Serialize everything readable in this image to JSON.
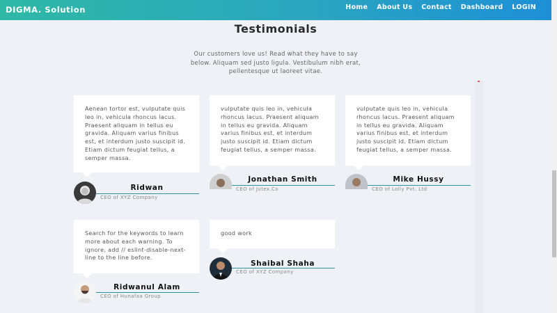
{
  "nav": {
    "brand": "DIGMA. Solution",
    "links": [
      "Home",
      "About Us",
      "Contact",
      "Dashboard",
      "LOGIN"
    ]
  },
  "section": {
    "title": "Testimonials",
    "subtitle": "Our customers love us! Read what they have to say below. Aliquam sed justo ligula. Vestibulum nibh erat, pellentesque ut laoreet vitae."
  },
  "testimonials": [
    {
      "text": "Aenean tortor est, vulputate quis leo in, vehicula rhoncus lacus. Praesent aliquam in tellus eu gravida. Aliquam varius finibus est, et interdum justo suscipit id. Etiam dictum feugiat tellus, a semper massa.",
      "name": "Ridwan",
      "role": "CEO of XYZ Company"
    },
    {
      "text": "vulputate quis leo in, vehicula rhoncus lacus. Praesent aliquam in tellus eu gravida. Aliquam varius finibus est, et interdum justo suscipit id. Etiam dictum feugiat tellus, a semper massa.",
      "name": "Jonathan Smith",
      "role": "CEO of Jutex.Co"
    },
    {
      "text": "vulputate quis leo in, vehicula rhoncus lacus. Praesent aliquam in tellus eu gravida. Aliquam varius finibus est, et interdum justo suscipit id. Etiam dictum feugiat tellus, a semper massa.",
      "name": "Mike Hussy",
      "role": "CEO of Lolly Pvt. Ltd"
    },
    {
      "text": "Search for the keywords to learn more about each warning. To ignore, add // eslint-disable-next-line to the line before.",
      "name": "Ridwanul Alam",
      "role": "CEO of Hunafaa Group"
    },
    {
      "text": "good work",
      "name": "Shaibal Shaha",
      "role": "CEO of XYZ Company"
    }
  ],
  "colors": {
    "accent": "#2a8fb0",
    "nav_start": "#2fb8a6",
    "nav_end": "#1e8fd6"
  }
}
